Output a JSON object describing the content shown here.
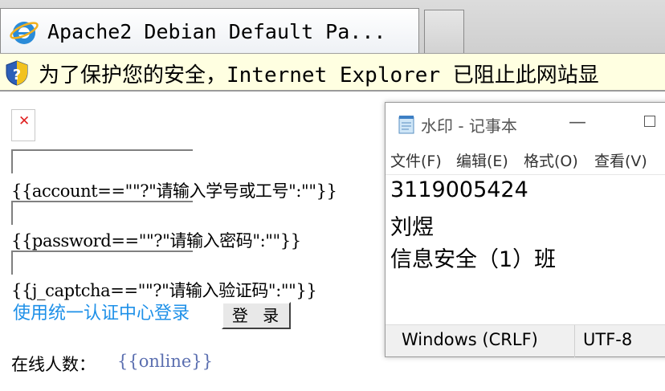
{
  "browser": {
    "tab_title": "Apache2 Debian Default Pa...",
    "infobar_text": "为了保护您的安全，Internet Explorer 已阻止此网站显"
  },
  "page": {
    "account_template": "{{account==\"\"?\"请输入学号或工号\":\"\"}}",
    "password_template": "{{password==\"\"?\"请输入密码\":\"\"}}",
    "captcha_template": "{{j_captcha==\"\"?\"请输入验证码\":\"\"}}",
    "cas_link": "使用统一认证中心登录",
    "login_button": "登 录",
    "online_label": "在线人数：",
    "online_value": "{{online}}"
  },
  "notepad": {
    "title": "水印 - 记事本",
    "minimize_glyph": "—",
    "menu": [
      "文件(F)",
      "编辑(E)",
      "格式(O)",
      "查看(V)"
    ],
    "lines": [
      "3119005424",
      "刘煜",
      "信息安全（1）班"
    ],
    "status_line_ending": "Windows (CRLF)",
    "status_encoding": "UTF-8"
  },
  "colors": {
    "link": "#1e90e8",
    "template_var": "#5b6fb0",
    "infobar_bg": "#ffffe1",
    "broken_image_x": "#e02020"
  },
  "icons": {
    "tab_icon": "ie-logo-icon",
    "infobar_icon": "shield-icon",
    "broken_image": "broken-image-icon",
    "notepad_icon": "notepad-icon"
  }
}
